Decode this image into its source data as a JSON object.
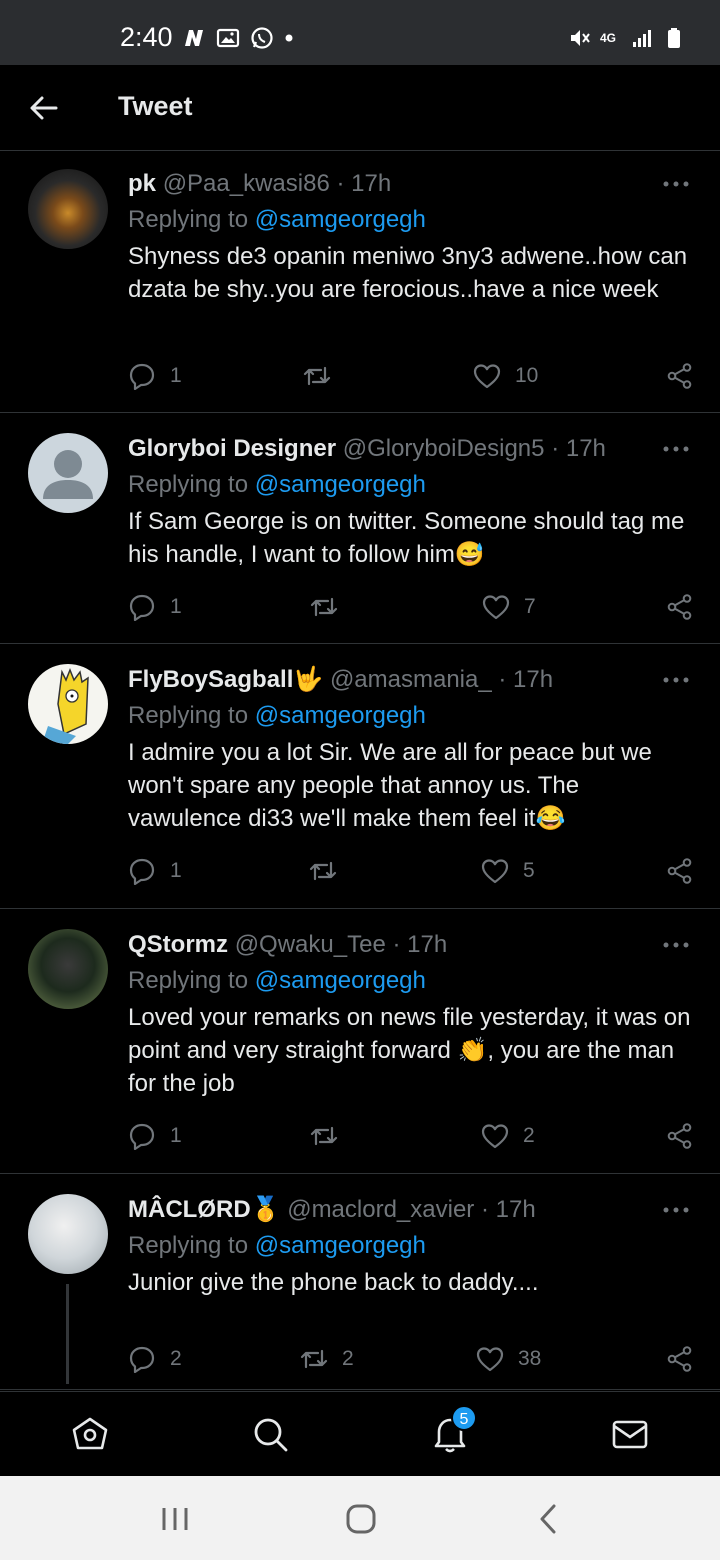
{
  "status_bar": {
    "time": "2:40",
    "network": "4G"
  },
  "header": {
    "title": "Tweet"
  },
  "tweets": [
    {
      "name": "pk",
      "handle": "@Paa_kwasi86",
      "time": "· 17h",
      "replying_label": "Replying to",
      "replying_to": "@samgeorgegh",
      "text": "Shyness de3 opanin meniwo 3ny3 adwene..how can dzata be shy..you are ferocious..have a nice week",
      "replies": "1",
      "retweets": "",
      "likes": "10"
    },
    {
      "name": "Gloryboi Designer",
      "handle": "@GloryboiDesign5",
      "time": "· 17h",
      "replying_label": "Replying to",
      "replying_to": "@samgeorgegh",
      "text": "If Sam George is on twitter. Someone should tag me his handle, I want to follow him😅",
      "replies": "1",
      "retweets": "",
      "likes": "7"
    },
    {
      "name": "FlyBoySagball🤟",
      "handle": "@amasmania_",
      "time": "· 17h",
      "replying_label": "Replying to",
      "replying_to": "@samgeorgegh",
      "text": "I admire you a lot Sir. We are all for peace but we won't spare any people that annoy us. The vawulence di33 we'll make them feel it😂",
      "replies": "1",
      "retweets": "",
      "likes": "5"
    },
    {
      "name": "QStormz",
      "handle": "@Qwaku_Tee",
      "time": "· 17h",
      "replying_label": "Replying to",
      "replying_to": "@samgeorgegh",
      "text": "Loved your remarks on news file yesterday, it was on point and very straight forward 👏, you are the man for the job",
      "replies": "1",
      "retweets": "",
      "likes": "2"
    },
    {
      "name": "MÂCLØRD🥇",
      "handle": "@maclord_xavier",
      "time": "· 17h",
      "replying_label": "Replying to",
      "replying_to": "@samgeorgegh",
      "text": "Junior give the phone back to daddy....",
      "replies": "2",
      "retweets": "2",
      "likes": "38"
    }
  ],
  "bottom_nav": {
    "notifications_badge": "5"
  },
  "colors": {
    "accent": "#1d9bf0",
    "background": "#000000",
    "muted": "#71767b"
  }
}
